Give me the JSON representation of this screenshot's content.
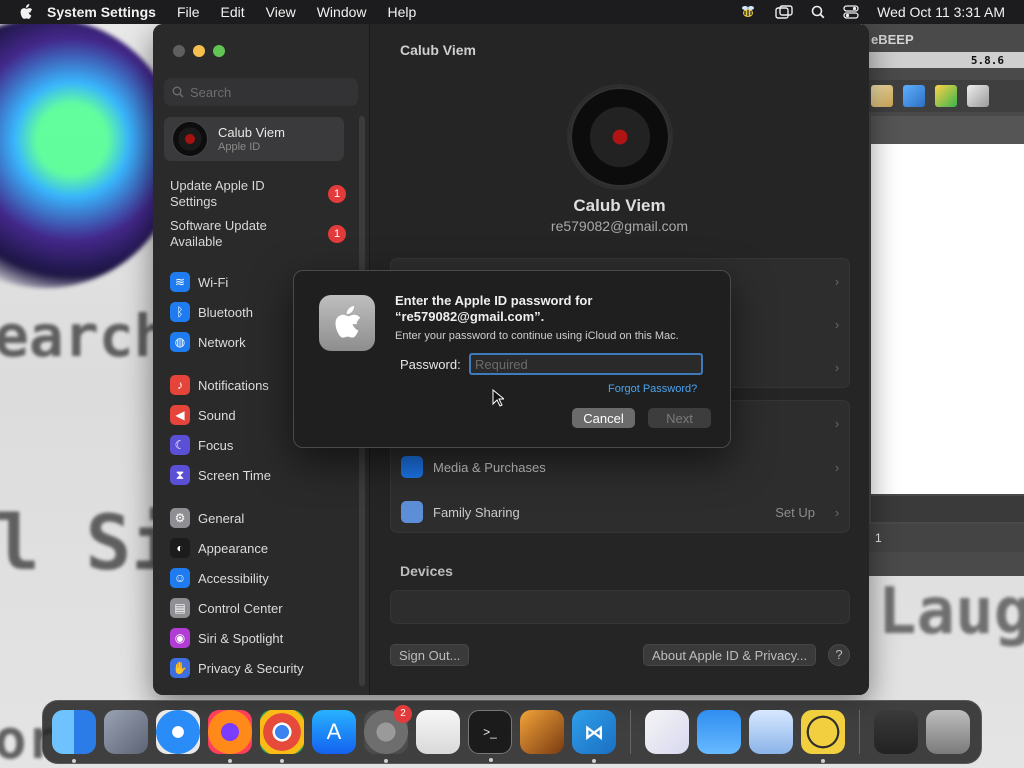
{
  "menubar": {
    "app_name": "System Settings",
    "menus": [
      "File",
      "Edit",
      "View",
      "Window",
      "Help"
    ],
    "datetime": "Wed Oct 11  3:31 AM"
  },
  "background_app": {
    "title": "eBEEP",
    "version": "5.8.6",
    "status_count": "1"
  },
  "settings": {
    "window_title": "Calub Viem",
    "search_placeholder": "Search",
    "account": {
      "name": "Calub Viem",
      "subtitle": "Apple ID"
    },
    "notices": [
      {
        "label": "Update Apple ID Settings",
        "badge": "1"
      },
      {
        "label": "Software Update Available",
        "badge": "1"
      }
    ],
    "nav": [
      {
        "label": "Wi-Fi",
        "icon": "wifi-icon",
        "color": "#1f7cf0"
      },
      {
        "label": "Bluetooth",
        "icon": "bluetooth-icon",
        "color": "#1f7cf0"
      },
      {
        "label": "Network",
        "icon": "globe-icon",
        "color": "#1f7cf0"
      },
      {
        "label": "Notifications",
        "icon": "bell-icon",
        "color": "#e5443b"
      },
      {
        "label": "Sound",
        "icon": "speaker-icon",
        "color": "#e5443b"
      },
      {
        "label": "Focus",
        "icon": "moon-icon",
        "color": "#5b4fd6"
      },
      {
        "label": "Screen Time",
        "icon": "hourglass-icon",
        "color": "#5b4fd6"
      },
      {
        "label": "General",
        "icon": "gear-icon",
        "color": "#8e8e93"
      },
      {
        "label": "Appearance",
        "icon": "appearance-icon",
        "color": "#1c1c1c"
      },
      {
        "label": "Accessibility",
        "icon": "accessibility-icon",
        "color": "#1f7cf0"
      },
      {
        "label": "Control Center",
        "icon": "control-center-icon",
        "color": "#8e8e93"
      },
      {
        "label": "Siri & Spotlight",
        "icon": "siri-icon",
        "color": "#b23dd6"
      },
      {
        "label": "Privacy & Security",
        "icon": "hand-icon",
        "color": "#3d6fe0"
      }
    ],
    "profile": {
      "name": "Calub Viem",
      "email": "re579082@gmail.com"
    },
    "rows": [
      {
        "label": "Media & Purchases",
        "value": ""
      },
      {
        "label": "Family Sharing",
        "value": "Set Up"
      }
    ],
    "devices_heading": "Devices",
    "sign_out": "Sign Out...",
    "about": "About Apple ID & Privacy...",
    "help": "?"
  },
  "dialog": {
    "title": "Enter the Apple ID password for “re579082@gmail.com”.",
    "subtitle": "Enter your password to continue using iCloud on this Mac.",
    "password_label": "Password:",
    "password_placeholder": "Required",
    "forgot": "Forgot Password?",
    "cancel": "Cancel",
    "next": "Next"
  },
  "dock": {
    "apps": [
      "finder",
      "launchpad",
      "safari",
      "firefox",
      "chrome",
      "app-store",
      "system-settings",
      "textedit",
      "terminal",
      "garageband",
      "vscode",
      "visual-studio",
      "weather",
      "preview",
      "beebeep",
      "window-preview",
      "trash"
    ],
    "settings_badge": "2"
  },
  "desktop": {
    "words": [
      "earch",
      "l Sing",
      "Laug",
      "or"
    ]
  }
}
